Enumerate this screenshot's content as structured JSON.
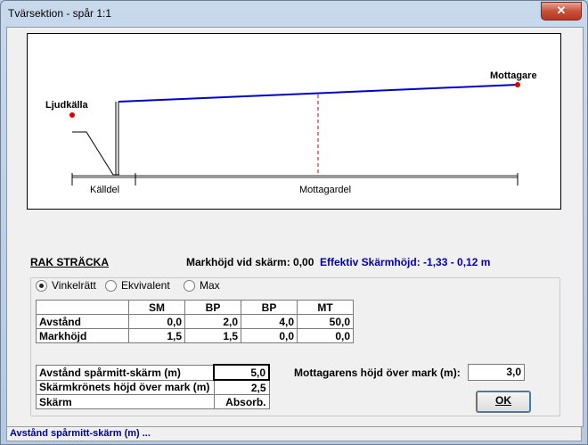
{
  "window": {
    "title": "Tvärsektion - spår 1:1",
    "close_glyph": "✕"
  },
  "diagram": {
    "source_label": "Ljudkälla",
    "receiver_label": "Mottagare",
    "source_part_label": "Källdel",
    "receiver_part_label": "Mottagardel"
  },
  "section": {
    "title": "RAK STRÄCKA",
    "ground_height_label": "Markhöjd vid skärm: 0,00",
    "effective_height_label": "Effektiv Skärmhöjd: -1,33 - 0,12 m"
  },
  "modes": [
    {
      "label": "Vinkelrätt",
      "selected": true
    },
    {
      "label": "Ekvivalent",
      "selected": false
    },
    {
      "label": "Max",
      "selected": false
    }
  ],
  "profile_table": {
    "headers": [
      "",
      "SM",
      "BP",
      "BP",
      "MT"
    ],
    "rows": [
      [
        "Avstånd",
        "0,0",
        "2,0",
        "4,0",
        "50,0"
      ],
      [
        "Markhöjd",
        "1,5",
        "1,5",
        "0,0",
        "0,0"
      ]
    ]
  },
  "screen_table": {
    "rows": [
      {
        "label": "Avstånd spårmitt-skärm (m)",
        "value": "5,0"
      },
      {
        "label": "Skärmkrönets höjd över mark (m)",
        "value": "2,5"
      },
      {
        "label": "Skärm",
        "value": "Absorb."
      }
    ]
  },
  "receiver_height": {
    "label": "Mottagarens höjd över mark (m):",
    "value": "3,0"
  },
  "ok_button": "OK",
  "status_bar": "Avstånd spårmitt-skärm (m) ...",
  "colors": {
    "line": "#0000cc",
    "source_dot": "#dd0000",
    "effective_label": "#0000aa"
  }
}
